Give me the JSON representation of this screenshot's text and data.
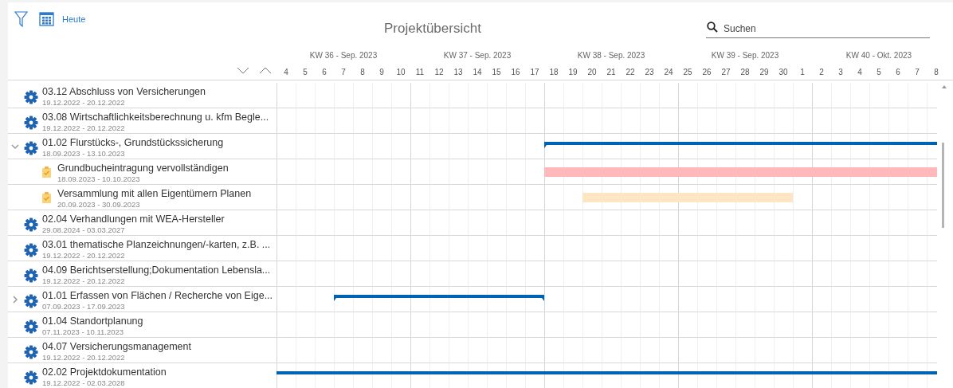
{
  "toolbar": {
    "today_link": "Heute",
    "title": "Projektübersicht",
    "search": {
      "placeholder": "Suchen"
    }
  },
  "timeline": {
    "weeks": [
      "KW 36 - Sep. 2023",
      "KW 37 - Sep. 2023",
      "KW 38 - Sep. 2023",
      "KW 39 - Sep. 2023",
      "KW 40 - Okt. 2023"
    ],
    "days": [
      "4",
      "5",
      "6",
      "7",
      "8",
      "9",
      "10",
      "11",
      "12",
      "13",
      "14",
      "15",
      "16",
      "17",
      "18",
      "19",
      "20",
      "21",
      "22",
      "23",
      "24",
      "25",
      "26",
      "27",
      "28",
      "29",
      "30",
      "1",
      "2",
      "3",
      "4",
      "5",
      "6",
      "7",
      "8"
    ]
  },
  "rows": [
    {
      "kind": "summary",
      "name": "03.12 Abschluss von Versicherungen",
      "dates": "19.12.2022 - 20.12.2022"
    },
    {
      "kind": "summary",
      "name": "03.08 Wirtschaftlichkeitsberechnung u. kfm Begle...",
      "dates": "19.12.2022 - 20.12.2022"
    },
    {
      "kind": "summary",
      "name": "01.02 Flurstücks-, Grundstückssicherung",
      "dates": "18.09.2023 - 13.10.2023",
      "expanded": true,
      "children": [
        {
          "kind": "task",
          "name": "Grundbucheintragung vervollständigen",
          "dates": "18.09.2023 - 10.10.2023",
          "color": "#ffb9bb"
        },
        {
          "kind": "task",
          "name": "Versammlung mit allen Eigentümern Planen",
          "dates": "20.09.2023 - 30.09.2023",
          "color": "#fde6c4"
        }
      ]
    },
    {
      "kind": "summary",
      "name": "02.04 Verhandlungen mit WEA-Hersteller",
      "dates": "29.08.2024 - 03.03.2027"
    },
    {
      "kind": "summary",
      "name": "03.01 thematische Planzeichnungen/-karten, z.B. ...",
      "dates": "19.12.2022 - 20.12.2022"
    },
    {
      "kind": "summary",
      "name": "04.09 Berichtserstellung;Dokumentation Lebensla...",
      "dates": "19.12.2022 - 20.12.2022"
    },
    {
      "kind": "summary",
      "name": "01.01 Erfassen von Flächen / Recherche von Eige...",
      "dates": "07.09.2023 - 17.09.2023",
      "expanded": false
    },
    {
      "kind": "summary",
      "name": "01.04 Standortplanung",
      "dates": "07.11.2023 - 10.11.2023"
    },
    {
      "kind": "summary",
      "name": "04.07 Versicherungsmanagement",
      "dates": "19.12.2022 - 20.12.2022"
    },
    {
      "kind": "summary",
      "name": "02.02 Projektdokumentation",
      "dates": "19.12.2022 - 02.03.2028"
    }
  ]
}
